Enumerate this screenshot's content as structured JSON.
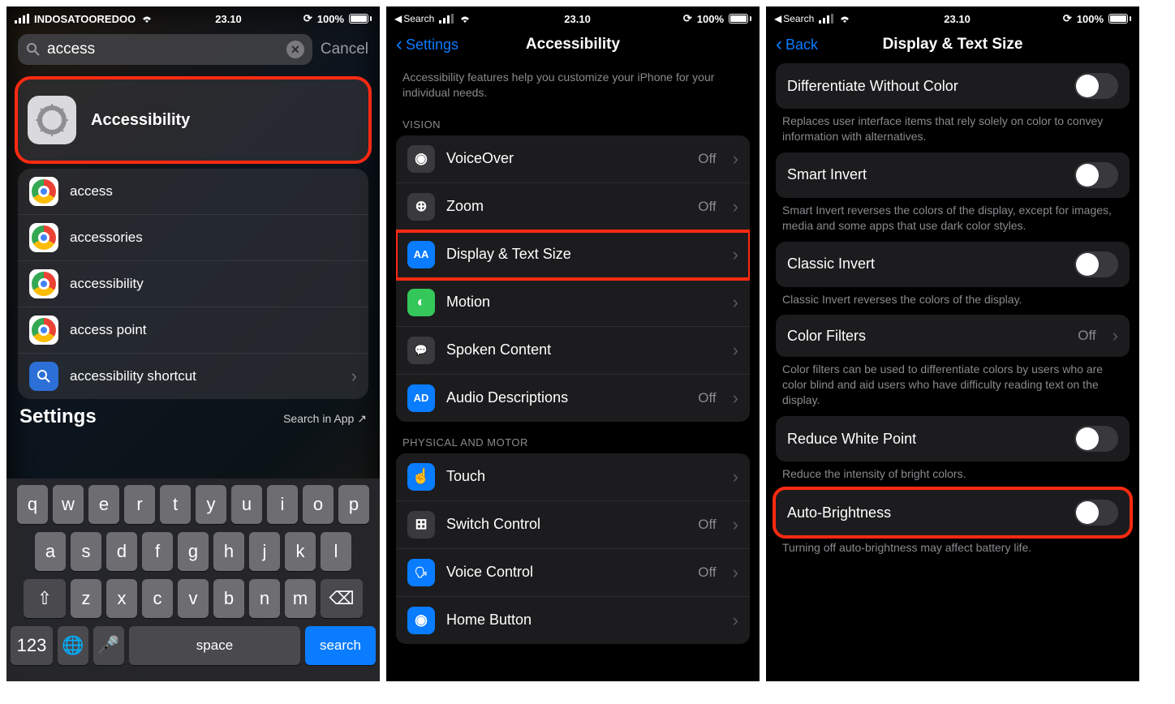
{
  "p1": {
    "status": {
      "carrier": "INDOSATOOREDOO",
      "time": "23.10",
      "battery": "100%"
    },
    "search": {
      "value": "access",
      "cancel": "Cancel"
    },
    "topResult": {
      "label": "Accessibility"
    },
    "suggestions": [
      {
        "label": "access",
        "icon": "chrome"
      },
      {
        "label": "accessories",
        "icon": "chrome"
      },
      {
        "label": "accessibility",
        "icon": "chrome"
      },
      {
        "label": "access point",
        "icon": "chrome"
      },
      {
        "label": "accessibility shortcut",
        "icon": "search"
      }
    ],
    "settingsHeader": {
      "title": "Settings",
      "searchInApp": "Search in App"
    },
    "keyboard": {
      "row1": [
        "q",
        "w",
        "e",
        "r",
        "t",
        "y",
        "u",
        "i",
        "o",
        "p"
      ],
      "row2": [
        "a",
        "s",
        "d",
        "f",
        "g",
        "h",
        "j",
        "k",
        "l"
      ],
      "row3": [
        "z",
        "x",
        "c",
        "v",
        "b",
        "n",
        "m"
      ],
      "numKey": "123",
      "space": "space",
      "search": "search"
    }
  },
  "p2": {
    "status": {
      "breadcrumb": "Search",
      "time": "23.10",
      "battery": "100%"
    },
    "nav": {
      "back": "Settings",
      "title": "Accessibility"
    },
    "intro": "Accessibility features help you customize your iPhone for your individual needs.",
    "sectionVision": "VISION",
    "vision": [
      {
        "name": "voiceover",
        "label": "VoiceOver",
        "value": "Off",
        "iconBg": "#3a3a3d",
        "iconGlyph": "◉"
      },
      {
        "name": "zoom",
        "label": "Zoom",
        "value": "Off",
        "iconBg": "#3a3a3d",
        "iconGlyph": "⊕"
      },
      {
        "name": "display-text",
        "label": "Display & Text Size",
        "value": "",
        "iconBg": "#0a7cff",
        "iconGlyph": "AA",
        "highlight": true
      },
      {
        "name": "motion",
        "label": "Motion",
        "value": "",
        "iconBg": "#34c759",
        "iconGlyph": "◐"
      },
      {
        "name": "spoken-content",
        "label": "Spoken Content",
        "value": "",
        "iconBg": "#3a3a3d",
        "iconGlyph": "💬"
      },
      {
        "name": "audio-descriptions",
        "label": "Audio Descriptions",
        "value": "Off",
        "iconBg": "#0a7cff",
        "iconGlyph": "AD"
      }
    ],
    "sectionPhysical": "PHYSICAL AND MOTOR",
    "physical": [
      {
        "name": "touch",
        "label": "Touch",
        "value": "",
        "iconBg": "#0a7cff",
        "iconGlyph": "☝"
      },
      {
        "name": "switch-control",
        "label": "Switch Control",
        "value": "Off",
        "iconBg": "#3a3a3d",
        "iconGlyph": "⊞"
      },
      {
        "name": "voice-control",
        "label": "Voice Control",
        "value": "Off",
        "iconBg": "#0a7cff",
        "iconGlyph": "🗣"
      },
      {
        "name": "home-button",
        "label": "Home Button",
        "value": "",
        "iconBg": "#0a7cff",
        "iconGlyph": "◉"
      }
    ]
  },
  "p3": {
    "status": {
      "breadcrumb": "Search",
      "time": "23.10",
      "battery": "100%"
    },
    "nav": {
      "back": "Back",
      "title": "Display & Text Size"
    },
    "rows": [
      {
        "name": "diff-without-color",
        "label": "Differentiate Without Color",
        "type": "toggle",
        "on": false,
        "desc": "Replaces user interface items that rely solely on color to convey information with alternatives."
      },
      {
        "name": "smart-invert",
        "label": "Smart Invert",
        "type": "toggle",
        "on": false,
        "desc": "Smart Invert reverses the colors of the display, except for images, media and some apps that use dark color styles."
      },
      {
        "name": "classic-invert",
        "label": "Classic Invert",
        "type": "toggle",
        "on": false,
        "desc": "Classic Invert reverses the colors of the display."
      },
      {
        "name": "color-filters",
        "label": "Color Filters",
        "type": "link",
        "value": "Off",
        "desc": "Color filters can be used to differentiate colors by users who are color blind and aid users who have difficulty reading text on the display."
      },
      {
        "name": "reduce-white-point",
        "label": "Reduce White Point",
        "type": "toggle",
        "on": false,
        "desc": "Reduce the intensity of bright colors."
      },
      {
        "name": "auto-brightness",
        "label": "Auto-Brightness",
        "type": "toggle",
        "on": false,
        "highlight": true,
        "desc": "Turning off auto-brightness may affect battery life."
      }
    ]
  }
}
